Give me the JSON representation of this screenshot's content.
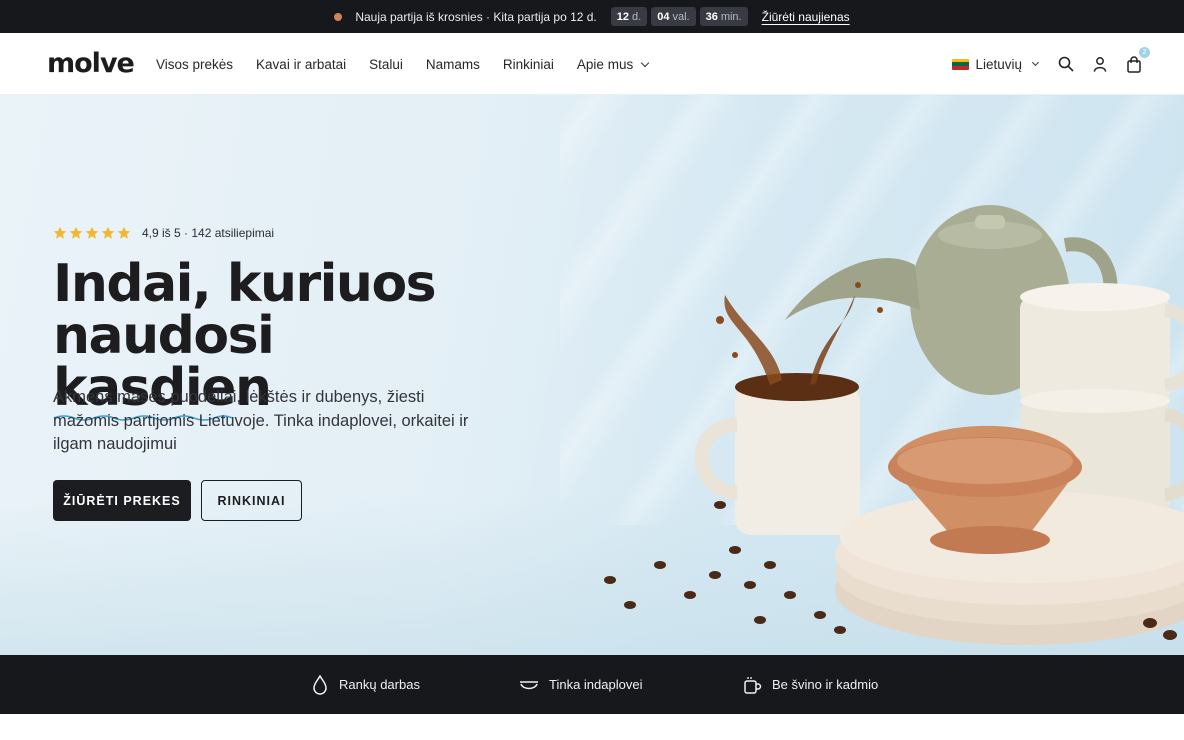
{
  "announcement": {
    "message": "Nauja partija iš krosnies · Kita partija po 12 d.",
    "countdown": [
      {
        "value": "12",
        "unit": "d."
      },
      {
        "value": "04",
        "unit": "val."
      },
      {
        "value": "36",
        "unit": "min."
      }
    ],
    "link": "Žiūrėti naujienas",
    "dot_color": "#d0865a"
  },
  "header": {
    "logo": "molve",
    "nav": [
      {
        "label": "Visos prekės"
      },
      {
        "label": "Kavai ir arbatai"
      },
      {
        "label": "Stalui"
      },
      {
        "label": "Namams"
      },
      {
        "label": "Rinkiniai"
      },
      {
        "label": "Apie mus",
        "has_dropdown": true
      }
    ],
    "language": "Lietuvių",
    "icons": [
      "search-icon",
      "account-icon",
      "cart-icon"
    ],
    "cart_count": "2"
  },
  "hero": {
    "rating_text": "4,9 iš 5 · 142 atsiliepimai",
    "stars": 5,
    "star_color": "#f2b731",
    "title_line1": "Indai, kuriuos naudosi",
    "title_line2": "kasdien",
    "subtitle": "Akmens masės puodeliai, lėkštės ir dubenys, žiesti mažomis partijomis Lietuvoje. Tinka indaplovei, orkaitei ir ilgam naudojimui",
    "primary_button": "Žiūrėti prekes",
    "secondary_button": "Rinkiniai",
    "accent_color": "#3c9cd4"
  },
  "features": [
    {
      "label": "Rankų darbas",
      "icon": "hand-made-icon"
    },
    {
      "label": "Tinka indaplovei",
      "icon": "dish-icon"
    },
    {
      "label": "Be švino ir kadmio",
      "icon": "mug-icon"
    }
  ]
}
